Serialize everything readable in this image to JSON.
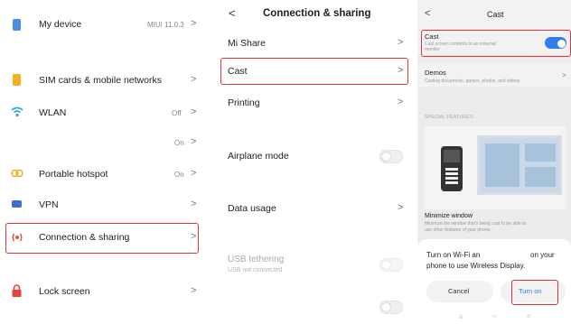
{
  "colors": {
    "accent": "#2f7df0",
    "highlight": "#d9363e"
  },
  "settings": {
    "my_device": {
      "label": "My device",
      "value": "MIUI 11.0.3"
    },
    "sim": {
      "label": "SIM cards & mobile networks"
    },
    "wlan": {
      "label": "WLAN",
      "value": "Off"
    },
    "bluetooth_value": "On",
    "hotspot": {
      "label": "Portable hotspot",
      "value": "On"
    },
    "vpn": {
      "label": "VPN"
    },
    "connection": {
      "label": "Connection & sharing"
    },
    "lock": {
      "label": "Lock screen"
    },
    "chevron": ">"
  },
  "connection": {
    "back": "<",
    "title": "Connection & sharing",
    "items": {
      "mishare": "Mi Share",
      "cast": "Cast",
      "printing": "Printing",
      "airplane": "Airplane mode",
      "data_usage": "Data usage",
      "usb_tethering": "USB tethering",
      "usb_status": "USB not connected"
    }
  },
  "cast": {
    "back": "<",
    "title": "Cast",
    "cast_item": {
      "label": "Cast",
      "sub": "Cast screen contents to an external monitor"
    },
    "demos": {
      "label": "Demos",
      "sub": "Casting documents, games, photos, and videos"
    },
    "section": "SPECIAL FEATURES",
    "minimize": {
      "label": "Minimize window",
      "sub1": "Minimize the window that's being cast to be able to",
      "sub2": "use other features of your phone."
    },
    "dialog": {
      "line1_a": "Turn on Wi-Fi an",
      "line1_b": "on your",
      "line2": "phone to use Wireless Display.",
      "cancel": "Cancel",
      "turn_on": "Turn on"
    },
    "nav": {
      "menu": "≡",
      "home": "○",
      "back": "<"
    }
  }
}
